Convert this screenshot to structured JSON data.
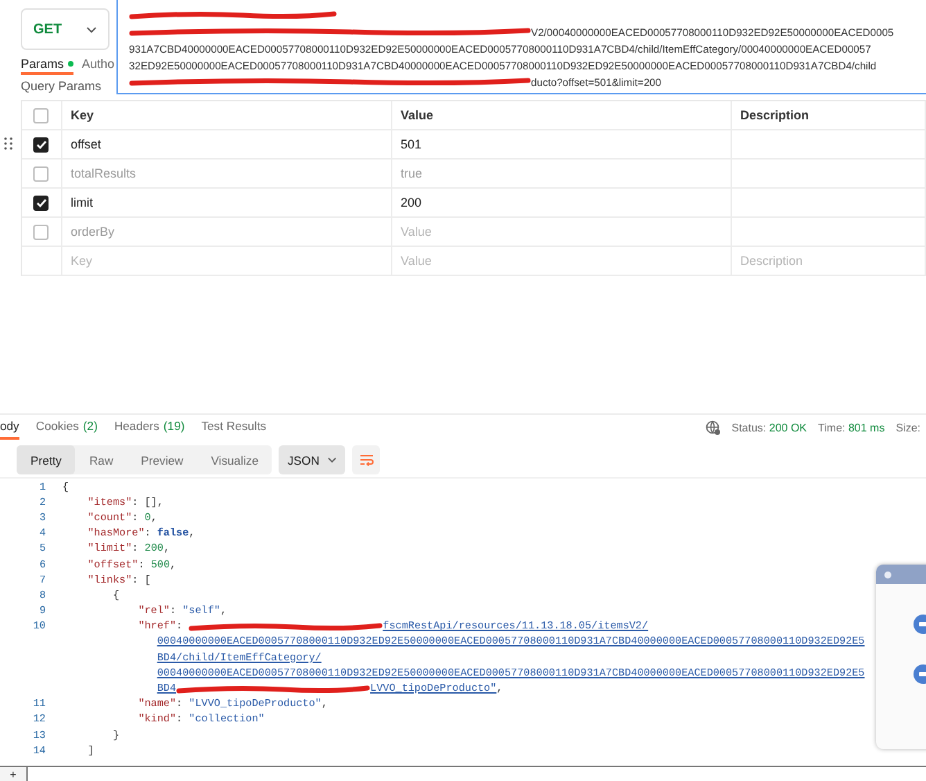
{
  "request": {
    "method": "GET",
    "url_lines": [
      {
        "segments": [
          {
            "kind": "redaction"
          }
        ]
      },
      {
        "segments": [
          {
            "kind": "redaction"
          },
          {
            "kind": "text",
            "text": "V2/00040000000EACED00057708000110D932ED92E50000000EACED0005"
          }
        ]
      },
      {
        "segments": [
          {
            "kind": "text",
            "text": "931A7CBD40000000EACED00057708000110D932ED92E50000000EACED00057708000110D931A7CBD4/child/ItemEffCategory/00040000000EACED00057"
          }
        ]
      },
      {
        "segments": [
          {
            "kind": "text",
            "text": "32ED92E50000000EACED00057708000110D931A7CBD40000000EACED00057708000110D932ED92E50000000EACED00057708000110D931A7CBD4/child"
          }
        ]
      },
      {
        "segments": [
          {
            "kind": "redaction"
          },
          {
            "kind": "text",
            "text": "ducto?offset=501&limit=200"
          }
        ]
      }
    ]
  },
  "request_tabs": [
    {
      "label": "Params",
      "dot": true,
      "selected": true
    },
    {
      "label": "Autho",
      "dot": false,
      "selected": false
    }
  ],
  "params_title": "Query Params",
  "params_table": {
    "columns": [
      "Key",
      "Value",
      "Description"
    ],
    "header_checked": false,
    "rows": [
      {
        "key": "offset",
        "value": "501",
        "checked": true,
        "hovered": true
      },
      {
        "key": "totalResults",
        "value": "true",
        "checked": false,
        "hovered": false
      },
      {
        "key": "limit",
        "value": "200",
        "checked": true,
        "hovered": false
      },
      {
        "key": "orderBy",
        "value_placeholder": "Value",
        "checked": false,
        "hovered": false
      }
    ],
    "new_row": {
      "key_placeholder": "Key",
      "value_placeholder": "Value",
      "description_placeholder": "Description"
    }
  },
  "response_tabs": [
    {
      "label": "ody",
      "selected": true
    },
    {
      "label": "Cookies",
      "count": "(2)",
      "selected": false
    },
    {
      "label": "Headers",
      "count": "(19)",
      "selected": false
    },
    {
      "label": "Test Results",
      "selected": false
    }
  ],
  "response_meta": [
    {
      "label": "Status:",
      "value": "200 OK"
    },
    {
      "label": "Time:",
      "value": "801 ms"
    },
    {
      "label": "Size:"
    }
  ],
  "views": [
    {
      "label": "Pretty",
      "selected": true
    },
    {
      "label": "Raw",
      "selected": false
    },
    {
      "label": "Preview",
      "selected": false
    },
    {
      "label": "Visualize",
      "selected": false
    }
  ],
  "format": "JSON",
  "code_lines": [
    {
      "number": "1",
      "rows": [
        [
          {
            "kind": "punct",
            "text": "{"
          }
        ]
      ]
    },
    {
      "number": "2",
      "rows": [
        [
          {
            "kind": "punct",
            "text": "    "
          },
          {
            "kind": "key",
            "text": "\"items\""
          },
          {
            "kind": "punct",
            "text": ": [],"
          }
        ]
      ]
    },
    {
      "number": "3",
      "rows": [
        [
          {
            "kind": "punct",
            "text": "    "
          },
          {
            "kind": "key",
            "text": "\"count\""
          },
          {
            "kind": "punct",
            "text": ": "
          },
          {
            "kind": "number",
            "text": "0"
          },
          {
            "kind": "punct",
            "text": ","
          }
        ]
      ]
    },
    {
      "number": "4",
      "rows": [
        [
          {
            "kind": "punct",
            "text": "    "
          },
          {
            "kind": "key",
            "text": "\"hasMore\""
          },
          {
            "kind": "punct",
            "text": ": "
          },
          {
            "kind": "bool",
            "text": "false"
          },
          {
            "kind": "punct",
            "text": ","
          }
        ]
      ]
    },
    {
      "number": "5",
      "rows": [
        [
          {
            "kind": "punct",
            "text": "    "
          },
          {
            "kind": "key",
            "text": "\"limit\""
          },
          {
            "kind": "punct",
            "text": ": "
          },
          {
            "kind": "number",
            "text": "200"
          },
          {
            "kind": "punct",
            "text": ","
          }
        ]
      ]
    },
    {
      "number": "6",
      "rows": [
        [
          {
            "kind": "punct",
            "text": "    "
          },
          {
            "kind": "key",
            "text": "\"offset\""
          },
          {
            "kind": "punct",
            "text": ": "
          },
          {
            "kind": "number",
            "text": "500"
          },
          {
            "kind": "punct",
            "text": ","
          }
        ]
      ]
    },
    {
      "number": "7",
      "rows": [
        [
          {
            "kind": "punct",
            "text": "    "
          },
          {
            "kind": "key",
            "text": "\"links\""
          },
          {
            "kind": "punct",
            "text": ": ["
          }
        ]
      ]
    },
    {
      "number": "8",
      "rows": [
        [
          {
            "kind": "punct",
            "text": "        {"
          }
        ]
      ]
    },
    {
      "number": "9",
      "rows": [
        [
          {
            "kind": "punct",
            "text": "            "
          },
          {
            "kind": "key",
            "text": "\"rel\""
          },
          {
            "kind": "punct",
            "text": ": "
          },
          {
            "kind": "string",
            "text": "\"self\""
          },
          {
            "kind": "punct",
            "text": ","
          }
        ]
      ]
    },
    {
      "number": "10",
      "rows": [
        [
          {
            "kind": "punct",
            "text": "            "
          },
          {
            "kind": "key",
            "text": "\"href\""
          },
          {
            "kind": "punct",
            "text": ": "
          },
          {
            "kind": "redaction"
          },
          {
            "kind": "link",
            "text": "fscmRestApi/resources/11.13.18.05/itemsV2/"
          }
        ],
        [
          {
            "kind": "punct",
            "text": "               "
          },
          {
            "kind": "link",
            "text": "00040000000EACED00057708000110D932ED92E50000000EACED00057708000110D931A7CBD40000000EACED00057708000110D932ED92E5"
          }
        ],
        [
          {
            "kind": "punct",
            "text": "               "
          },
          {
            "kind": "link",
            "text": "BD4/child/ItemEffCategory/"
          }
        ],
        [
          {
            "kind": "punct",
            "text": "               "
          },
          {
            "kind": "link",
            "text": "00040000000EACED00057708000110D932ED92E50000000EACED00057708000110D931A7CBD40000000EACED00057708000110D932ED92E5"
          }
        ],
        [
          {
            "kind": "punct",
            "text": "               "
          },
          {
            "kind": "link",
            "text": "BD4"
          },
          {
            "kind": "redaction"
          },
          {
            "kind": "link",
            "text": "LVVO_tipoDeProducto\""
          },
          {
            "kind": "punct",
            "text": ","
          }
        ]
      ]
    },
    {
      "number": "11",
      "rows": [
        [
          {
            "kind": "punct",
            "text": "            "
          },
          {
            "kind": "key",
            "text": "\"name\""
          },
          {
            "kind": "punct",
            "text": ": "
          },
          {
            "kind": "string",
            "text": "\"LVVO_tipoDeProducto\""
          },
          {
            "kind": "punct",
            "text": ","
          }
        ]
      ]
    },
    {
      "number": "12",
      "rows": [
        [
          {
            "kind": "punct",
            "text": "            "
          },
          {
            "kind": "key",
            "text": "\"kind\""
          },
          {
            "kind": "punct",
            "text": ": "
          },
          {
            "kind": "string",
            "text": "\"collection\""
          }
        ]
      ]
    },
    {
      "number": "13",
      "rows": [
        [
          {
            "kind": "punct",
            "text": "        }"
          }
        ]
      ]
    },
    {
      "number": "14",
      "rows": [
        [
          {
            "kind": "punct",
            "text": "    ]"
          }
        ]
      ]
    }
  ],
  "bottom_bar": {
    "add_label": "+"
  }
}
